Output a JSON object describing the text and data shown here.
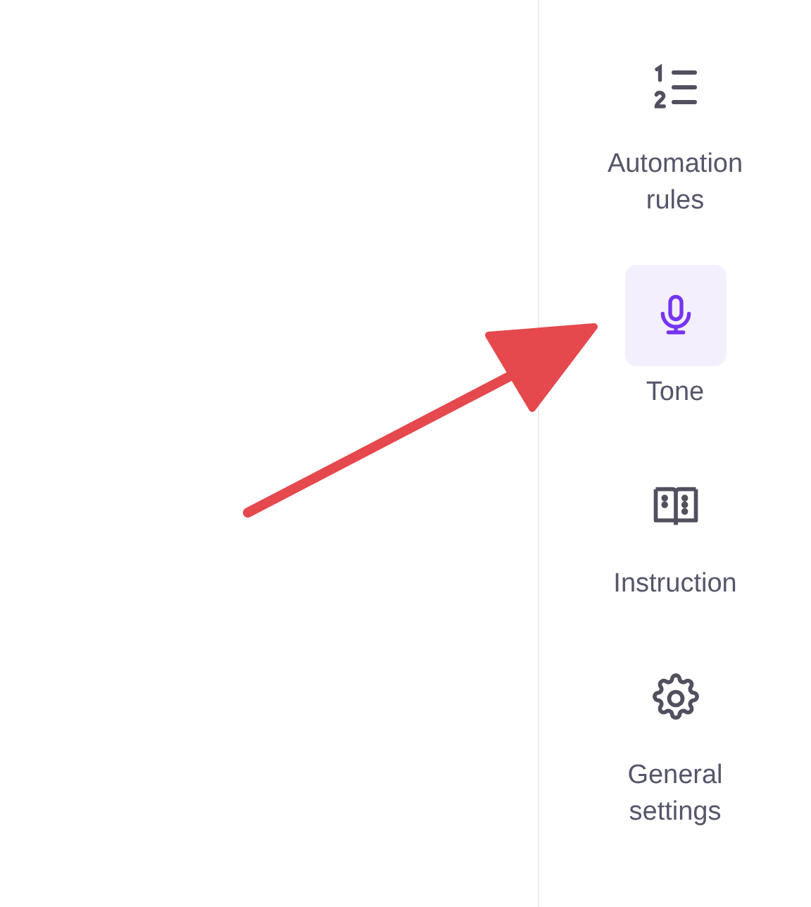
{
  "sidebar": {
    "items": [
      {
        "kind": "numbered-list",
        "label": "Automation rules",
        "selected": false
      },
      {
        "kind": "microphone",
        "label": "Tone",
        "selected": true
      },
      {
        "kind": "book",
        "label": "Instruction",
        "selected": false
      },
      {
        "kind": "gear",
        "label": "General settings",
        "selected": false
      }
    ]
  }
}
